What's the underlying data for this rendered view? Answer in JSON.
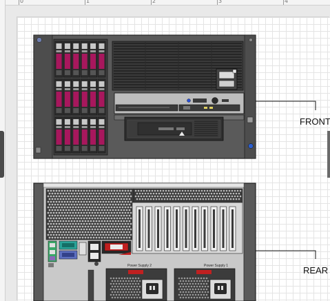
{
  "ruler": {
    "ticks": [
      "0",
      "1",
      "2",
      "3",
      "4"
    ]
  },
  "diagram": {
    "front_label": "FRONT",
    "rear_label": "REAR"
  },
  "rear_panel": {
    "power_supply_2": "Power Supply 2",
    "power_supply_1": "Power Supply 1"
  },
  "colors": {
    "chassis": "#5a5a5a",
    "drive_accent": "#a8175d",
    "drive_handle": "#c8c8c8",
    "connector_teal": "#2aa398",
    "connector_red": "#c02020"
  }
}
